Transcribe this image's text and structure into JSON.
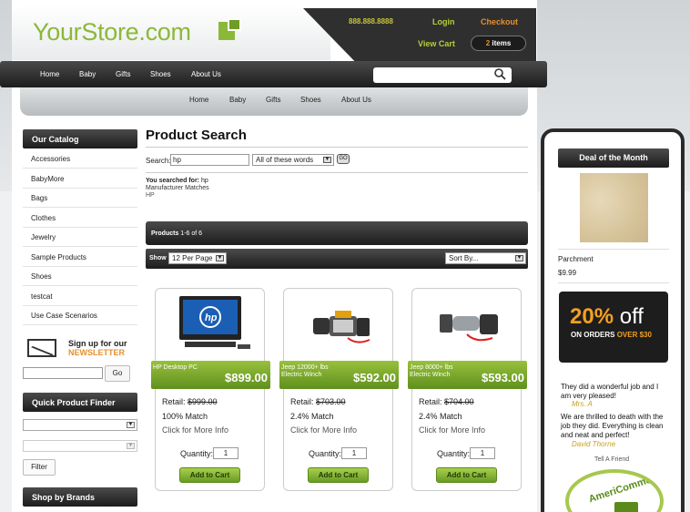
{
  "store": {
    "logo": "YourStore.com",
    "phone": "888.888.8888",
    "login": "Login",
    "checkout": "Checkout",
    "view_cart": "View Cart",
    "items_count": "2",
    "items_label": "items"
  },
  "nav": [
    "Home",
    "Baby",
    "Gifts",
    "Shoes",
    "About Us"
  ],
  "subnav": [
    "Home",
    "Baby",
    "Gifts",
    "Shoes",
    "About Us"
  ],
  "sidebar": {
    "catalog_title": "Our Catalog",
    "categories": [
      "Accessories",
      "BabyMore",
      "Bags",
      "Clothes",
      "Jewelry",
      "Sample Products",
      "Shoes",
      "testcat",
      "Use Case Scenarios"
    ],
    "newsletter_line1": "Sign up for our",
    "newsletter_line2": "NEWSLETTER",
    "go_label": "Go",
    "finder_title": "Quick Product Finder",
    "filter_label": "Filter",
    "brands_title": "Shop by Brands"
  },
  "search": {
    "page_title": "Product Search",
    "label": "Search:",
    "value": "hp",
    "mode": "All of these words",
    "go": "GO",
    "you_searched_label": "You searched for:",
    "you_searched_value": "hp",
    "manufacturer_label": "Manufacturer Matches",
    "manufacturer_value": "HP"
  },
  "results": {
    "products_label": "Products",
    "range": "1-6 of 6",
    "show_label": "Show",
    "per_page": "12 Per Page",
    "sort_by": "Sort By..."
  },
  "products": [
    {
      "name": "HP Desktop PC",
      "price": "$899.00",
      "retail_label": "Retail:",
      "retail": "$999.00",
      "match": "100% Match",
      "more": "Click for More Info",
      "qty_label": "Quantity:",
      "qty": "1",
      "add": "Add to Cart"
    },
    {
      "name": "Jeep 12000+ lbs Electric Winch",
      "price": "$592.00",
      "retail_label": "Retail:",
      "retail": "$703.00",
      "match": "2.4% Match",
      "more": "Click for More Info",
      "qty_label": "Quantity:",
      "qty": "1",
      "add": "Add to Cart"
    },
    {
      "name": "Jeep 8000+ lbs Electric Winch",
      "price": "$593.00",
      "retail_label": "Retail:",
      "retail": "$704.00",
      "match": "2.4% Match",
      "more": "Click for More Info",
      "qty_label": "Quantity:",
      "qty": "1",
      "add": "Add to Cart"
    }
  ],
  "right": {
    "deal_title": "Deal of the Month",
    "deal_name": "Parchment",
    "deal_price": "$9.99",
    "promo_pct": "20%",
    "promo_off": "off",
    "promo_on": "ON ORDERS",
    "promo_over": "OVER $30",
    "testimonial1": "They did a wonderful job and I am very pleased!",
    "author1": "Mrs. A",
    "testimonial2": "We are thrilled to death with the job they did. Everything is clean and neat and perfect!",
    "author2": "David Thorne",
    "tell_friend": "Tell A Friend",
    "seal": "AmeriCommerce"
  }
}
